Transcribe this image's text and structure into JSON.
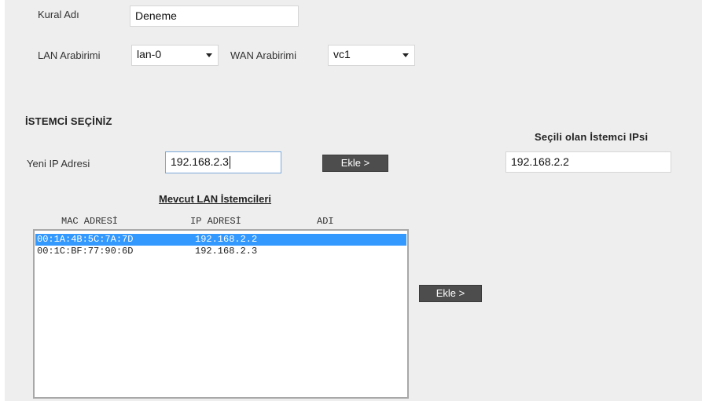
{
  "rule": {
    "name_label": "Kural Adı",
    "name_value": "Deneme"
  },
  "interfaces": {
    "lan_label": "LAN Arabirimi",
    "lan_value": "lan-0",
    "wan_label": "WAN Arabirimi",
    "wan_value": "vc1"
  },
  "client_section": {
    "heading": "İSTEMCİ SEÇİNİZ",
    "new_ip_label": "Yeni IP Adresi",
    "new_ip_value": "192.168.2.3",
    "add_button_1": "Ekle >",
    "selected_heading": "Seçili olan İstemci IPsi",
    "selected_value": "192.168.2.2"
  },
  "lan_clients": {
    "title": "Mevcut LAN İstemcileri",
    "columns": [
      "MAC ADRESİ",
      "IP ADRESİ",
      "ADI"
    ],
    "rows": [
      {
        "mac": "00:1A:4B:5C:7A:7D",
        "ip": "192.168.2.2",
        "name": "",
        "selected": true
      },
      {
        "mac": "00:1C:BF:77:90:6D",
        "ip": "192.168.2.3",
        "name": "",
        "selected": false
      }
    ],
    "add_button_2": "Ekle >"
  }
}
